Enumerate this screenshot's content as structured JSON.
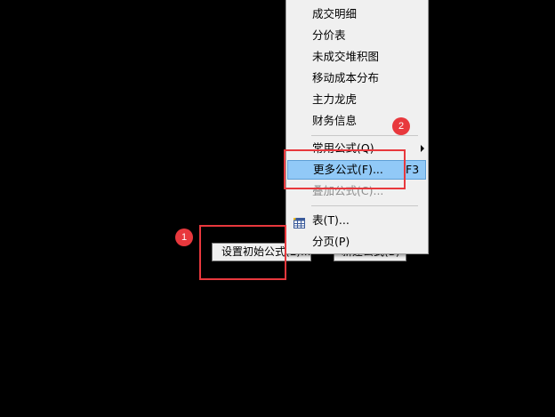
{
  "background_buttons": {
    "init_formula_label": "设置初始公式(E)...",
    "new_formula_label": "新建公式(B)"
  },
  "menu": {
    "items": [
      {
        "label": "成交明细"
      },
      {
        "label": "分价表"
      },
      {
        "label": "未成交堆积图"
      },
      {
        "label": "移动成本分布"
      },
      {
        "label": "主力龙虎"
      },
      {
        "label": "财务信息"
      },
      {
        "label": "常用公式(Q)"
      },
      {
        "label": "更多公式(F)...",
        "shortcut": "F3"
      },
      {
        "label": "叠加公式(C)..."
      },
      {
        "label": "表(T)..."
      },
      {
        "label": "分页(P)"
      }
    ],
    "icons": [
      "table-icon"
    ],
    "highlight_color": "#91c9f7"
  },
  "annotations": {
    "badge_1": "1",
    "badge_2": "2",
    "color": "#e8383d"
  }
}
